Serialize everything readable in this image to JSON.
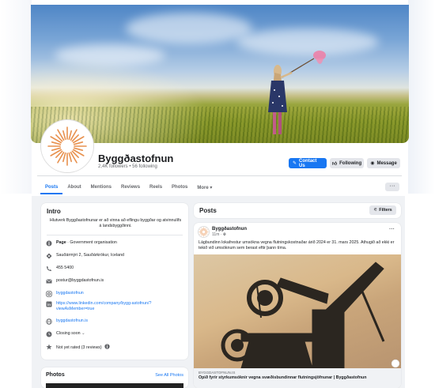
{
  "profile": {
    "name": "Byggðastofnun",
    "meta": "2,4K followers • 56 following",
    "buttons": {
      "contact": "Contact Us",
      "following": "Following",
      "message": "Message"
    }
  },
  "tabs": [
    "Posts",
    "About",
    "Mentions",
    "Reviews",
    "Reels",
    "Photos",
    "More ▾"
  ],
  "more_button": "···",
  "intro": {
    "title": "Intro",
    "bio": "Hlutverk Byggðastofnunar er að vinna að eflingu byggðar og atvinnulífs á landsbyggðinni.",
    "page_label": "Page",
    "page_type": " · Government organisation",
    "address": "Sauðármýri 2, Sauðárkrókur, Iceland",
    "phone": "455 5400",
    "email": "postur@byggdastofnun.is",
    "instagram": "byggdastofnun",
    "linkedin": "https://www.linkedin.com/company/bygg-astofnun/?viewAsMember=true",
    "website": "byggdastofnun.is",
    "hours": "Closing soon",
    "hours_chevron": "⌄",
    "rating": "Not yet rated (3 reviews)"
  },
  "photos": {
    "title": "Photos",
    "see_all": "See All Photos"
  },
  "posts": {
    "title": "Posts",
    "filters": "Filters",
    "post": {
      "author": "Byggðastofnun",
      "time": "11m · ",
      "more": "···",
      "text": "Lágbundinn lokafrestur umsókna vegna flutningskostnaðar árið 2024 er 31. mars 2025. Athugið að ekki er tekið við umsóknum sem berast eftir þann tíma.",
      "link_source": "BYGGDASTOFNUN.IS",
      "link_title": "Opið fyrir styrkumsóknir vegna svæðisbundinnar flutningsjöfnunar | Byggðastofnun"
    }
  },
  "colors": {
    "accent": "#1877f2",
    "background": "#f0f2f5",
    "logo": "#e8914e"
  }
}
